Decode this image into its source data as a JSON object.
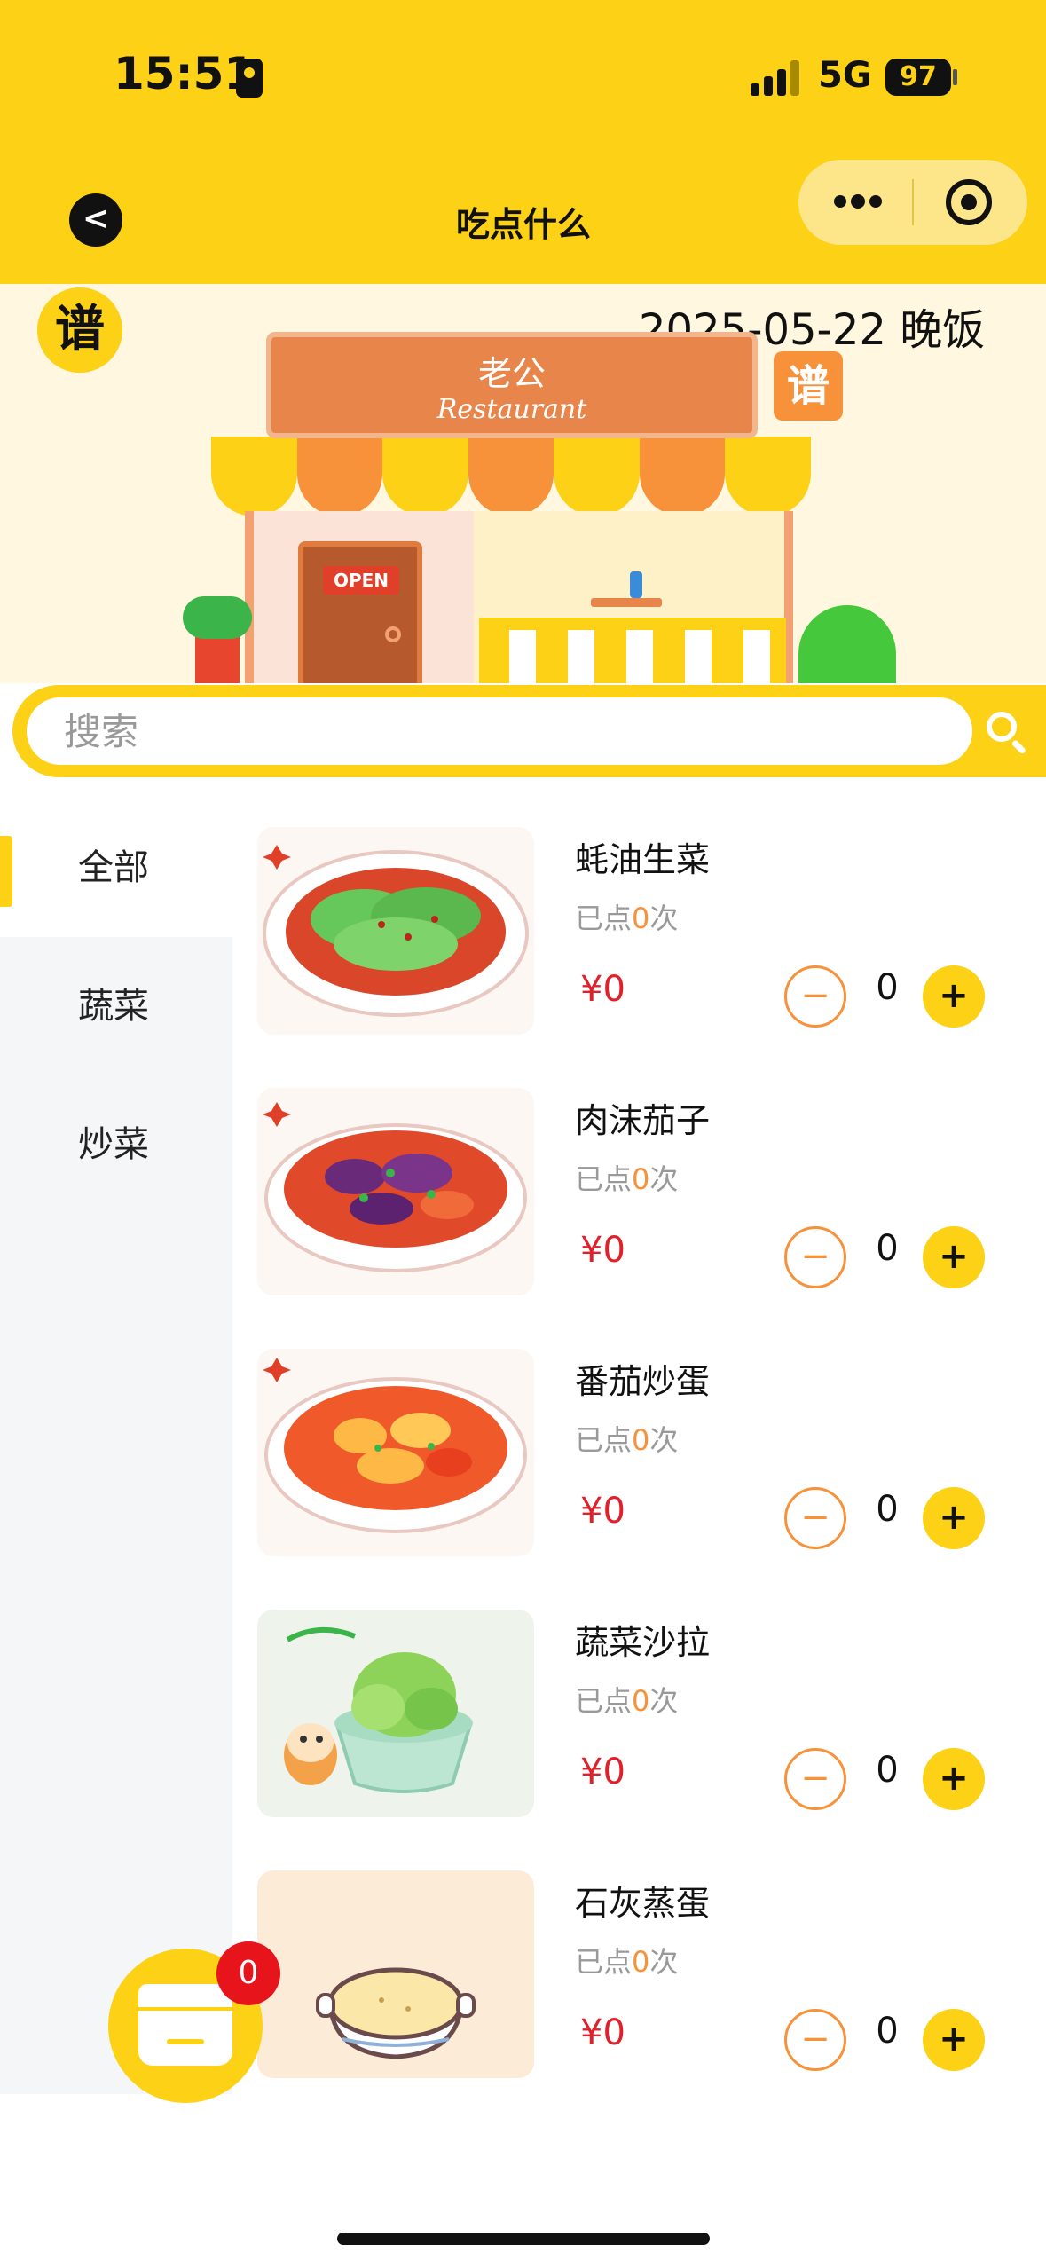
{
  "status_bar": {
    "time": "15:51",
    "network": "5G",
    "battery": "97"
  },
  "nav": {
    "back_label": "<",
    "title": "吃点什么"
  },
  "banner": {
    "logo_char": "谱",
    "date_meal": "2025-05-22  晚饭",
    "store_name": "老公",
    "store_sub": "Restaurant",
    "open_sign": "OPEN",
    "tag_char": "谱"
  },
  "search": {
    "placeholder": "搜索"
  },
  "categories": [
    {
      "label": "全部",
      "active": true
    },
    {
      "label": "蔬菜",
      "active": false
    },
    {
      "label": "炒菜",
      "active": false
    }
  ],
  "dish_labels": {
    "ordered_prefix": "已点",
    "ordered_suffix": "次",
    "minus": "−",
    "plus": "+"
  },
  "dishes": [
    {
      "name": "蚝油生菜",
      "ordered": "0",
      "price": "¥0",
      "qty": "0",
      "image": "lettuce-in-sauce"
    },
    {
      "name": "肉沫茄子",
      "ordered": "0",
      "price": "¥0",
      "qty": "0",
      "image": "eggplant-minced-pork"
    },
    {
      "name": "番茄炒蛋",
      "ordered": "0",
      "price": "¥0",
      "qty": "0",
      "image": "tomato-egg"
    },
    {
      "name": "蔬菜沙拉",
      "ordered": "0",
      "price": "¥0",
      "qty": "0",
      "image": "vegetable-salad"
    },
    {
      "name": "石灰蒸蛋",
      "ordered": "0",
      "price": "¥0",
      "qty": "0",
      "image": "steamed-egg"
    }
  ],
  "cart": {
    "count": "0"
  },
  "colors": {
    "brand_yellow": "#FCD116",
    "accent_orange": "#F7913A",
    "price_red": "#E0202A"
  }
}
